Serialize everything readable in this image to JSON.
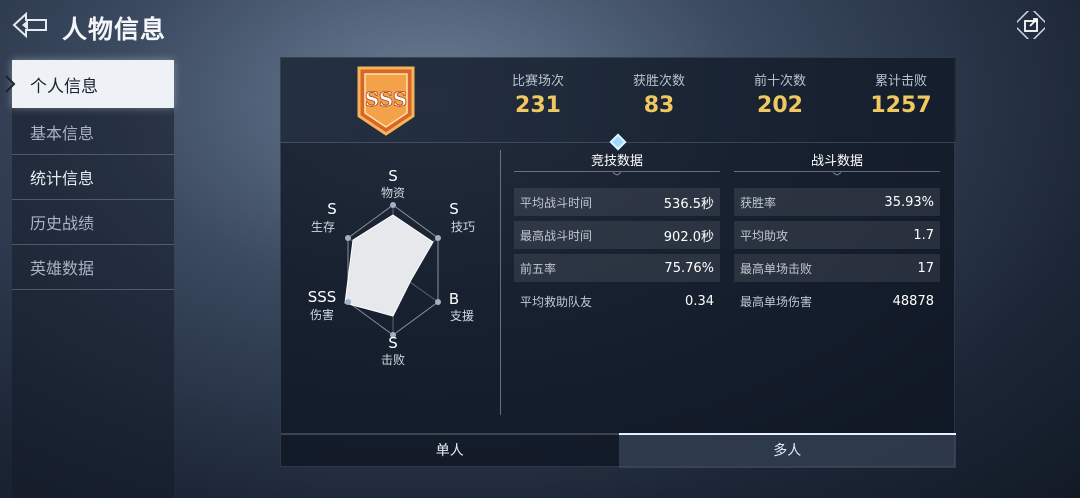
{
  "header": {
    "title": "人物信息",
    "back_icon": "back-arrow-icon",
    "share_icon": "share-export-icon"
  },
  "sidebar": {
    "items": [
      {
        "label": "个人信息"
      },
      {
        "label": "基本信息"
      },
      {
        "label": "统计信息"
      },
      {
        "label": "历史战绩"
      },
      {
        "label": "英雄数据"
      }
    ]
  },
  "rank_badge": {
    "text": "SSS"
  },
  "summary": [
    {
      "label": "比赛场次",
      "value": "231"
    },
    {
      "label": "获胜次数",
      "value": "83"
    },
    {
      "label": "前十次数",
      "value": "202"
    },
    {
      "label": "累计击败",
      "value": "1257"
    }
  ],
  "radar": {
    "axes": [
      {
        "name": "物资",
        "grade": "S"
      },
      {
        "name": "技巧",
        "grade": "S"
      },
      {
        "name": "支援",
        "grade": "B"
      },
      {
        "name": "击败",
        "grade": "S"
      },
      {
        "name": "伤害",
        "grade": "SSS"
      },
      {
        "name": "生存",
        "grade": "S"
      }
    ]
  },
  "competitive": {
    "title": "竞技数据",
    "rows": [
      {
        "k": "平均战斗时间",
        "v": "536.5秒"
      },
      {
        "k": "最高战斗时间",
        "v": "902.0秒"
      },
      {
        "k": "前五率",
        "v": "75.76%"
      },
      {
        "k": "平均救助队友",
        "v": "0.34"
      }
    ]
  },
  "combat": {
    "title": "战斗数据",
    "rows": [
      {
        "k": "获胜率",
        "v": "35.93%"
      },
      {
        "k": "平均助攻",
        "v": "1.7"
      },
      {
        "k": "最高单场击败",
        "v": "17"
      },
      {
        "k": "最高单场伤害",
        "v": "48878"
      }
    ]
  },
  "tabs": {
    "solo": "单人",
    "multi": "多人",
    "active": "multi"
  },
  "colors": {
    "accent_gold": "#f0c860",
    "badge_orange": "#e0782a"
  }
}
